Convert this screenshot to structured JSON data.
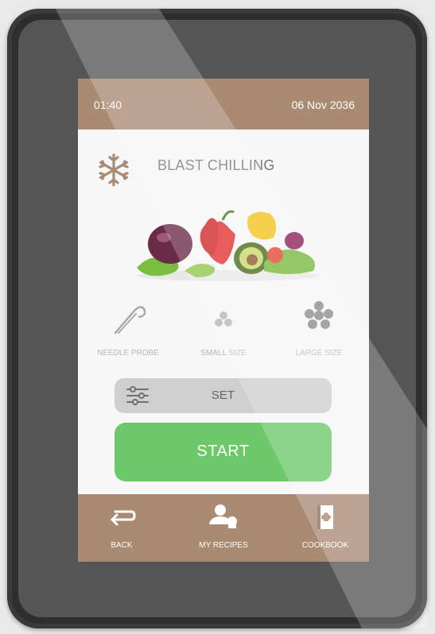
{
  "status": {
    "time": "01:40",
    "date": "06 Nov 2036"
  },
  "mode": {
    "title": "BLAST CHILLING",
    "icon": "snowflake-icon"
  },
  "image": {
    "semantic": "vegetables-image"
  },
  "options": [
    {
      "label": "NEEDLE PROBE",
      "icon": "needle-probe-icon"
    },
    {
      "label": "SMALL SIZE",
      "icon": "small-size-icon"
    },
    {
      "label": "LARGE SIZE",
      "icon": "large-size-icon"
    }
  ],
  "set": {
    "label": "SET",
    "icon": "sliders-icon"
  },
  "start": {
    "label": "START"
  },
  "nav": [
    {
      "label": "BACK",
      "icon": "back-arrow-icon"
    },
    {
      "label": "MY RECIPES",
      "icon": "chef-icon"
    },
    {
      "label": "COOKBOOK",
      "icon": "cookbook-icon"
    }
  ],
  "colors": {
    "brand": "#a98a72",
    "start": "#6cc868",
    "set": "#cfcfcf",
    "screen": "#f7f7f7"
  }
}
